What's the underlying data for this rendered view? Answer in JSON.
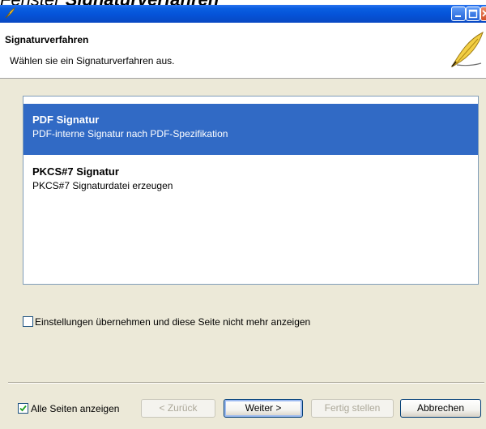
{
  "caption": {
    "prefix": "Fenster ",
    "emphasis": "Signaturverfahren"
  },
  "window": {
    "icon": "quill-icon"
  },
  "header": {
    "title": "Signaturverfahren",
    "subtitle": "Wählen sie ein Signaturverfahren aus.",
    "icon": "quill-icon"
  },
  "list": {
    "items": [
      {
        "title": "PDF Signatur",
        "description": "PDF-interne Signatur nach PDF-Spezifikation",
        "selected": true
      },
      {
        "title": "PKCS#7 Signatur",
        "description": "PKCS#7 Signaturdatei erzeugen",
        "selected": false
      }
    ]
  },
  "options": {
    "skip_page_label": "Einstellungen übernehmen und diese Seite nicht mehr anzeigen",
    "skip_page_checked": false
  },
  "footer": {
    "show_all_label": "Alle Seiten anzeigen",
    "show_all_checked": true,
    "back_label": "< Zurück",
    "next_label": "Weiter >",
    "finish_label": "Fertig stellen",
    "cancel_label": "Abbrechen"
  },
  "colors": {
    "selection": "#316ac5",
    "titlebar": "#0553d8",
    "dialog_bg": "#ece9d8"
  }
}
